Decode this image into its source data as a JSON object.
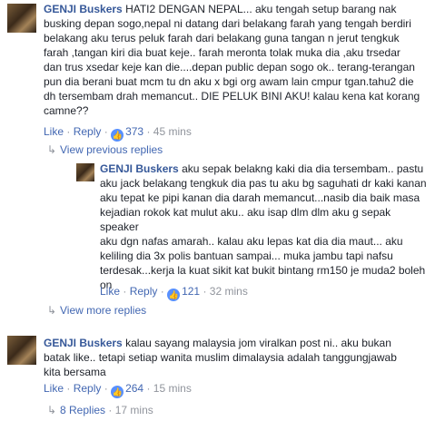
{
  "comments": [
    {
      "author": "GENJI Buskers",
      "text": "HATI2 DENGAN NEPAL... aku tengah setup barang nak\nbusking depan sogo,nepal ni datang dari belakang farah yang tengah berdiri\nbelakang aku terus peluk farah dari belakang guna tangan n jerut tengkuk\nfarah ,tangan kiri dia buat keje.. farah meronta tolak muka dia ,aku trsedar\ndan trus xsedar keje kan die....depan public depan sogo ok.. terang-terangan\npun dia berani buat mcm tu dn aku x bgi org awam lain cmpur tgan.tahu2 die\ndh tersembam drah memancut.. DIE PELUK BINI AKU! kalau kena kat korang\ncamne??",
      "like": "Like",
      "reply": "Reply",
      "likes": "373",
      "time": "45 mins"
    },
    {
      "author": "GENJI Buskers",
      "text": "aku sepak belakng kaki dia dia tersembam.. pastu\naku jack belakang tengkuk dia pas tu aku bg saguhati dr kaki kanan\naku tepat ke pipi kanan dia darah memancut...nasib dia baik masa\nkejadian rokok kat mulut aku.. aku isap dlm dlm aku g sepak speaker\naku dgn nafas amarah.. kalau aku lepas kat dia dia maut... aku\nkeliling dia 3x polis bantuan sampai... muka jambu tapi nafsu\nterdesak...kerja la kuat sikit kat bukit bintang rm150 je muda2 boleh\non",
      "like": "Like",
      "reply": "Reply",
      "likes": "121",
      "time": "32 mins"
    },
    {
      "author": "GENJI Buskers",
      "text": "kalau sayang malaysia jom viralkan post ni.. aku bukan\nbatak like.. tetapi setiap wanita muslim dimalaysia adalah tanggungjawab\nkita bersama",
      "like": "Like",
      "reply": "Reply",
      "likes": "264",
      "time": "15 mins"
    }
  ],
  "view_previous": "View previous replies",
  "view_more": "View more replies",
  "replies_link": "8 Replies",
  "replies_time": "17 mins",
  "separator": "·",
  "like_glyph": "👍"
}
